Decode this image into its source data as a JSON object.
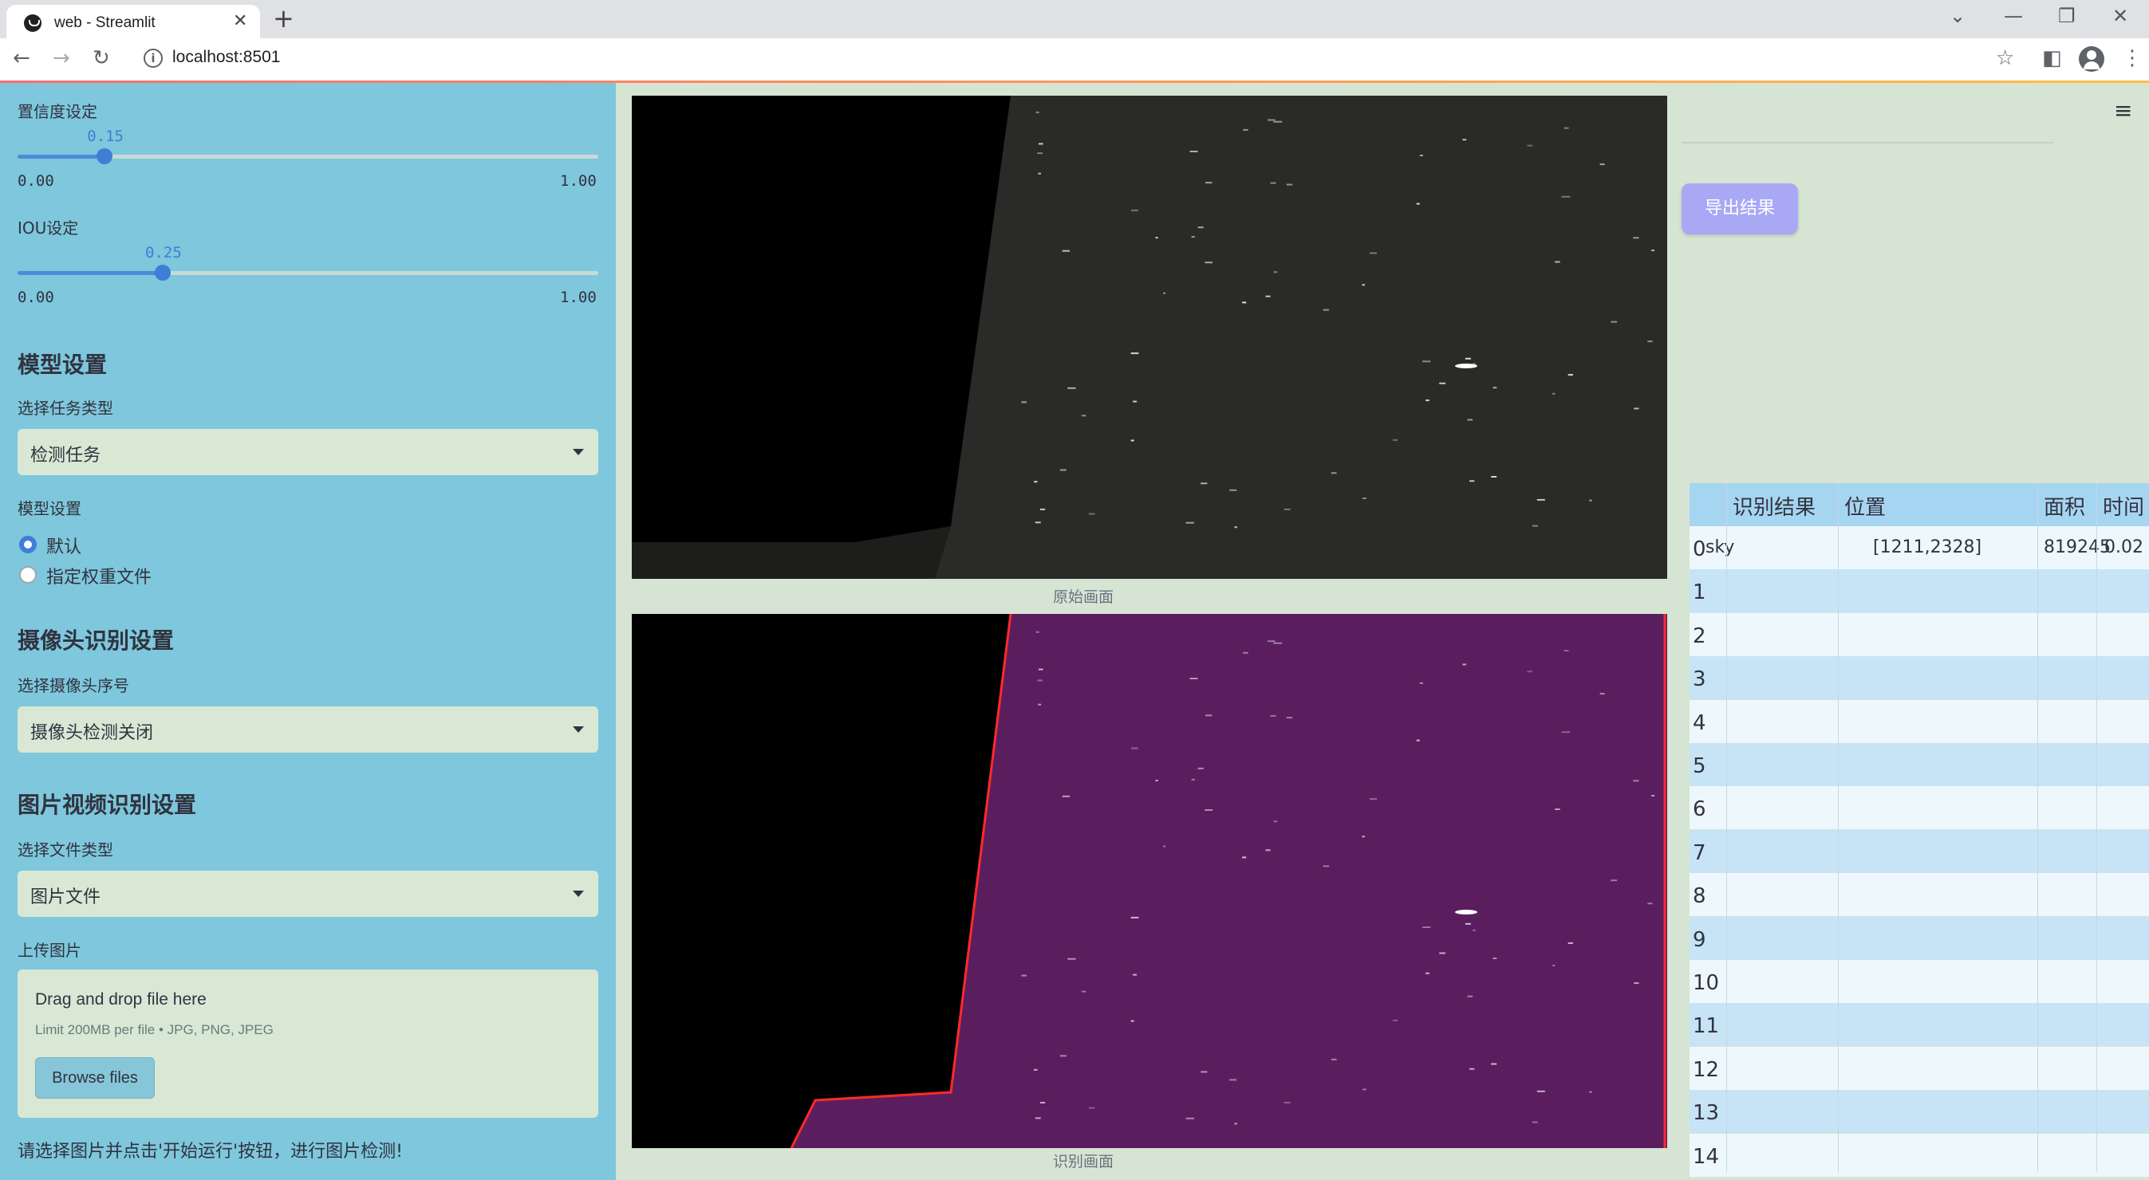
{
  "browser": {
    "tab_title": "web - Streamlit",
    "url": "localhost:8501"
  },
  "sidebar": {
    "confidence": {
      "label": "置信度设定",
      "value": "0.15",
      "fraction": 0.15,
      "min": "0.00",
      "max": "1.00"
    },
    "iou": {
      "label": "IOU设定",
      "value": "0.25",
      "fraction": 0.25,
      "min": "0.00",
      "max": "1.00"
    },
    "model_header": "模型设置",
    "task_label": "选择任务类型",
    "task_value": "检测任务",
    "model_label": "模型设置",
    "model_options": [
      "默认",
      "指定权重文件"
    ],
    "model_selected": "默认",
    "camera_header": "摄像头识别设置",
    "camera_label": "选择摄像头序号",
    "camera_value": "摄像头检测关闭",
    "media_header": "图片视频识别设置",
    "file_type_label": "选择文件类型",
    "file_type_value": "图片文件",
    "upload_label": "上传图片",
    "upload_title": "Drag and drop file here",
    "upload_limit": "Limit 200MB per file • JPG, PNG, JPEG",
    "browse_label": "Browse files",
    "hint": "请选择图片并点击'开始运行'按钮，进行图片检测!"
  },
  "main": {
    "caption_original": "原始画面",
    "caption_result": "识别画面"
  },
  "right": {
    "export_label": "导出结果",
    "table": {
      "headers": [
        "识别结果",
        "位置",
        "面积",
        "时间"
      ],
      "rows": [
        {
          "index": "0",
          "result": "sky",
          "position": "[1211,2328]",
          "area": "819245",
          "time": "0.02"
        },
        {
          "index": "1"
        },
        {
          "index": "2"
        },
        {
          "index": "3"
        },
        {
          "index": "4"
        },
        {
          "index": "5"
        },
        {
          "index": "6"
        },
        {
          "index": "7"
        },
        {
          "index": "8"
        },
        {
          "index": "9"
        },
        {
          "index": "10"
        },
        {
          "index": "11"
        },
        {
          "index": "12"
        },
        {
          "index": "13"
        },
        {
          "index": "14"
        }
      ]
    }
  },
  "colors": {
    "sidebar_bg": "#7ec7dc",
    "main_bg": "#d6e5d3",
    "accent": "#3e7ed6",
    "export_button": "#a9a8f5",
    "mask_purple": "#5c1f5c",
    "table_header": "#a6d5f2"
  },
  "icons": [
    "streamlit-favicon",
    "close-icon",
    "plus-icon",
    "back-icon",
    "forward-icon",
    "reload-icon",
    "info-icon",
    "star-icon",
    "sidepanel-icon",
    "avatar",
    "kebab-icon",
    "hamburger-icon"
  ]
}
